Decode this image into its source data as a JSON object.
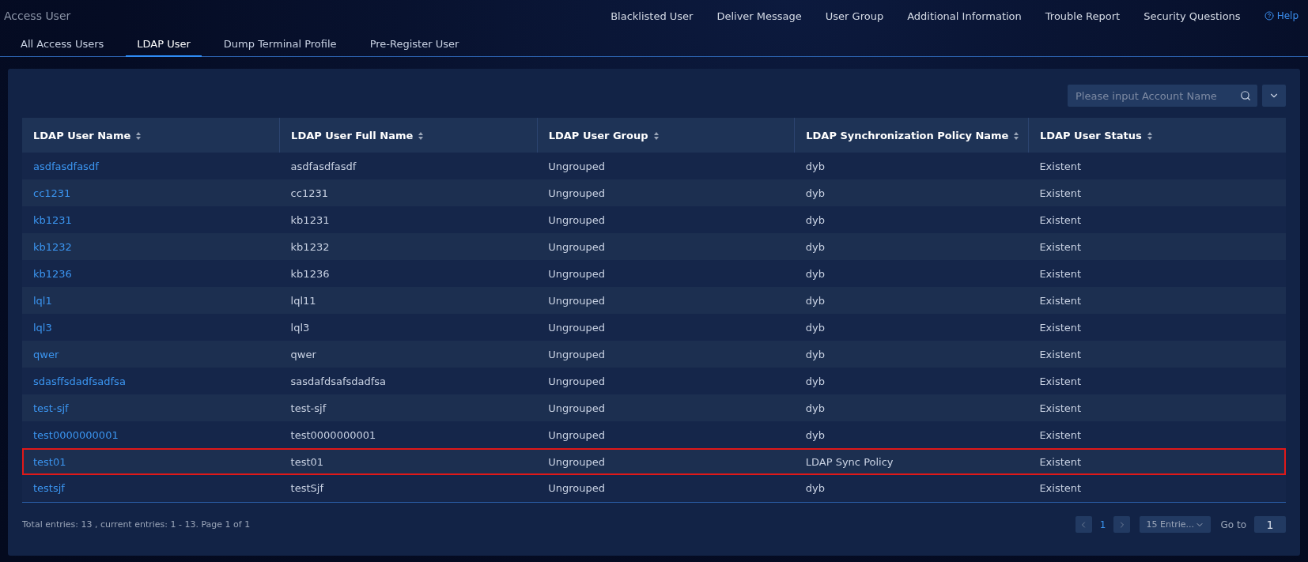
{
  "header": {
    "title": "Access User",
    "links": [
      "Blacklisted User",
      "Deliver Message",
      "User Group",
      "Additional Information",
      "Trouble Report",
      "Security Questions"
    ],
    "help": "Help"
  },
  "tabs": [
    {
      "label": "All Access Users",
      "selected": false
    },
    {
      "label": "LDAP User",
      "selected": true
    },
    {
      "label": "Dump Terminal Profile",
      "selected": false
    },
    {
      "label": "Pre-Register User",
      "selected": false
    }
  ],
  "search": {
    "placeholder": "Please input Account Name"
  },
  "table": {
    "columns": [
      "LDAP User Name",
      "LDAP User Full Name",
      "LDAP User Group",
      "LDAP Synchronization Policy Name",
      "LDAP User Status"
    ],
    "rows": [
      {
        "cells": [
          "asdfasdfasdf",
          "asdfasdfasdf",
          "Ungrouped",
          "dyb",
          "Existent"
        ],
        "highlighted": false
      },
      {
        "cells": [
          "cc1231",
          "cc1231",
          "Ungrouped",
          "dyb",
          "Existent"
        ],
        "highlighted": false
      },
      {
        "cells": [
          "kb1231",
          "kb1231",
          "Ungrouped",
          "dyb",
          "Existent"
        ],
        "highlighted": false
      },
      {
        "cells": [
          "kb1232",
          "kb1232",
          "Ungrouped",
          "dyb",
          "Existent"
        ],
        "highlighted": false
      },
      {
        "cells": [
          "kb1236",
          "kb1236",
          "Ungrouped",
          "dyb",
          "Existent"
        ],
        "highlighted": false
      },
      {
        "cells": [
          "lql1",
          "lql11",
          "Ungrouped",
          "dyb",
          "Existent"
        ],
        "highlighted": false
      },
      {
        "cells": [
          "lql3",
          "lql3",
          "Ungrouped",
          "dyb",
          "Existent"
        ],
        "highlighted": false
      },
      {
        "cells": [
          "qwer",
          "qwer",
          "Ungrouped",
          "dyb",
          "Existent"
        ],
        "highlighted": false
      },
      {
        "cells": [
          "sdasffsdadfsadfsa",
          "sasdafdsafsdadfsa",
          "Ungrouped",
          "dyb",
          "Existent"
        ],
        "highlighted": false
      },
      {
        "cells": [
          "test-sjf",
          "test-sjf",
          "Ungrouped",
          "dyb",
          "Existent"
        ],
        "highlighted": false
      },
      {
        "cells": [
          "test0000000001",
          "test0000000001",
          "Ungrouped",
          "dyb",
          "Existent"
        ],
        "highlighted": false
      },
      {
        "cells": [
          "test01",
          "test01",
          "Ungrouped",
          "LDAP Sync Policy",
          "Existent"
        ],
        "highlighted": true
      },
      {
        "cells": [
          "testsjf",
          "testSjf",
          "Ungrouped",
          "dyb",
          "Existent"
        ],
        "highlighted": false
      }
    ]
  },
  "footer": {
    "summary": "Total entries: 13 , current entries: 1 - 13. Page 1 of 1",
    "page": "1",
    "page_size": "15 Entrie...",
    "goto_label": "Go to",
    "goto_value": "1"
  }
}
